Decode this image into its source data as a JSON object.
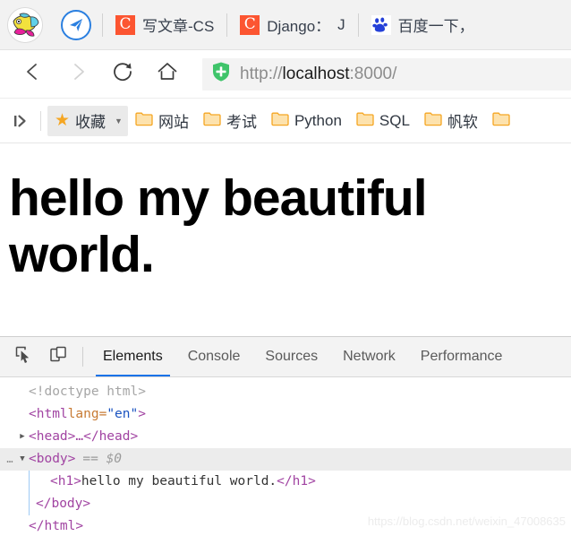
{
  "browser": {
    "profile_avatar_icon": "fish-avatar-icon",
    "new_tab_icon": "paper-plane-icon",
    "tabs": [
      {
        "favicon": "csdn-icon",
        "title": "写文章-CS",
        "title_dim": "",
        "active": false
      },
      {
        "favicon": "csdn-icon",
        "title": "Django：",
        "title_dim": "J",
        "active": false
      },
      {
        "favicon": "baidu-icon",
        "title": "百度一下，",
        "title_dim": "",
        "active": false
      }
    ],
    "nav": {
      "back_icon": "back-arrow-icon",
      "forward_icon": "forward-arrow-icon",
      "reload_icon": "reload-icon",
      "home_icon": "home-icon"
    },
    "omnibox": {
      "security_icon": "green-shield-plus-icon",
      "url_scheme": "http://",
      "url_host": "localhost",
      "url_port_path": ":8000/"
    },
    "bookmarks": {
      "toggle_icon": "sidebar-expand-icon",
      "favorites_label": "收藏",
      "star_icon": "star-icon",
      "caret_icon": "chevron-down-icon",
      "folders": [
        {
          "label": "网站"
        },
        {
          "label": "考试"
        },
        {
          "label": "Python"
        },
        {
          "label": "SQL"
        },
        {
          "label": "帆软"
        },
        {
          "label": ""
        }
      ]
    }
  },
  "page": {
    "heading": "hello my beautiful world."
  },
  "devtools": {
    "inspect_icon": "inspect-element-icon",
    "device_icon": "device-toolbar-icon",
    "tabs": [
      {
        "label": "Elements",
        "active": true
      },
      {
        "label": "Console",
        "active": false
      },
      {
        "label": "Sources",
        "active": false
      },
      {
        "label": "Network",
        "active": false
      },
      {
        "label": "Performance",
        "active": false
      }
    ],
    "dom": {
      "line_doctype": "<!doctype html>",
      "line_html_open_a": "<html ",
      "line_html_attr": "lang=",
      "line_html_attr_value": "\"en\"",
      "line_html_open_b": ">",
      "line_head": "<head>…</head>",
      "line_head_triangle": "▶",
      "line_body_ellipsis": "…",
      "line_body_triangle": "▼",
      "line_body": "<body>",
      "line_body_selected_marker": "== $0",
      "line_h1_open": "<h1>",
      "line_h1_text": " hello my beautiful world.",
      "line_h1_close": "</h1>",
      "line_body_close": "</body>",
      "line_html_close": "</html>"
    }
  },
  "watermark": "https://blog.csdn.net/weixin_47008635",
  "colors": {
    "accent": "#1a73e8",
    "csdn_orange": "#fc5531",
    "folder_orange": "#f5a623",
    "shield_green": "#3fc46a"
  }
}
